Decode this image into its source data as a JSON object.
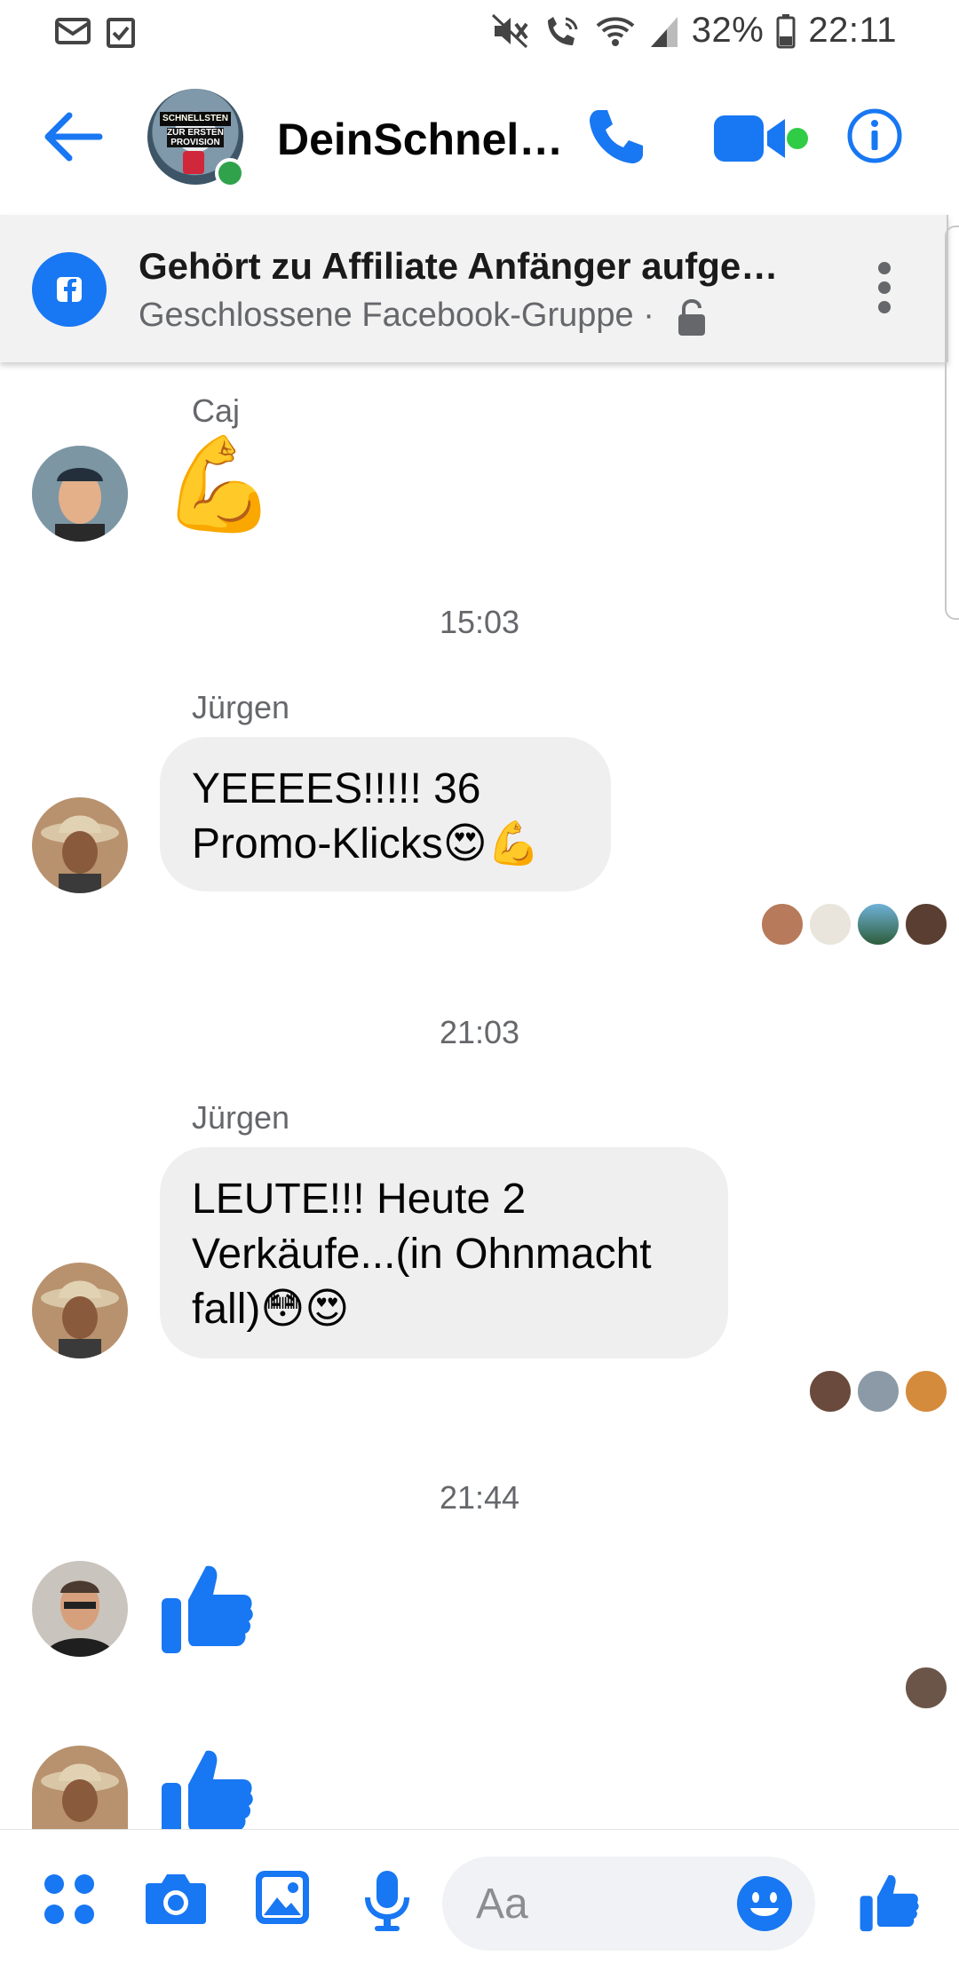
{
  "status_bar": {
    "battery": "32%",
    "time": "22:11",
    "icons": [
      "mail-icon",
      "task-check-icon",
      "mute-icon",
      "wifi-call-icon",
      "wifi-icon",
      "signal-icon",
      "battery-icon"
    ]
  },
  "header": {
    "title": "DeinSchnel…",
    "avatar_text": [
      "SCHNELLSTEN",
      "ZUR ERSTEN",
      "PROVISION"
    ],
    "icons": [
      "back-arrow-icon",
      "phone-icon",
      "video-icon",
      "info-icon"
    ]
  },
  "group_banner": {
    "title": "Gehört zu Affiliate Anfänger aufge…",
    "subtitle": "Geschlossene Facebook-Gruppe ·",
    "icons": [
      "facebook-icon",
      "lock-icon",
      "more-vertical-icon"
    ]
  },
  "messages": {
    "m1": {
      "sender": "Caj",
      "emoji": "💪"
    },
    "t1": "15:03",
    "m2": {
      "sender": "Jürgen",
      "text_line1": "YEEEES!!!!! 36",
      "text_line2": "Promo-Klicks😍💪"
    },
    "t2": "21:03",
    "m3": {
      "sender": "Jürgen",
      "text_line1": "LEUTE!!!  Heute 2",
      "text_line2": "Verkäufe...(in Ohnmacht",
      "text_line3": "fall)😳😍"
    },
    "t3": "21:44"
  },
  "composer": {
    "placeholder": "Aa",
    "icons": [
      "apps-icon",
      "camera-icon",
      "image-icon",
      "microphone-icon",
      "emoji-icon",
      "like-icon"
    ]
  },
  "colors": {
    "accent": "#1877f2",
    "online": "#31a24c",
    "bubble": "#efefef",
    "secondary_text": "#65676b"
  }
}
